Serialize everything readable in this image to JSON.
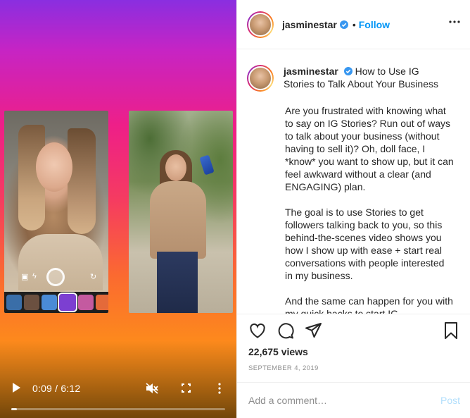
{
  "video": {
    "time_display": "0:09 / 6:12",
    "progress": 0.025,
    "icons": [
      "play-icon",
      "mute-icon",
      "fullscreen-icon",
      "more-vert-icon"
    ]
  },
  "post": {
    "username": "jasminestar",
    "follow_label": "Follow",
    "separator": "•",
    "caption": {
      "title": "How to Use IG Stories to Talk About Your Business",
      "paragraphs": [
        "Are you frustrated with knowing what to say on IG Stories? Run out of ways to talk about your business (without having to sell it)? Oh, doll face, I *know* you want to show up, but it can feel awkward without a clear (and ENGAGING) plan.",
        "The goal is to use Stories to get followers talking back to you, so this behind-the-scenes video shows you how I show up with ease + start real conversations with people interested in my business.",
        "And the same can happen for you with my quick hacks to start IG"
      ]
    },
    "views": "22,675 views",
    "date": "SEPTEMBER 4, 2019",
    "comment": {
      "placeholder": "Add a comment…",
      "post_label": "Post"
    }
  },
  "colors": {
    "accent": "#0095f6",
    "post_disabled": "#b2dffc",
    "muted_text": "#8e8e8e"
  }
}
